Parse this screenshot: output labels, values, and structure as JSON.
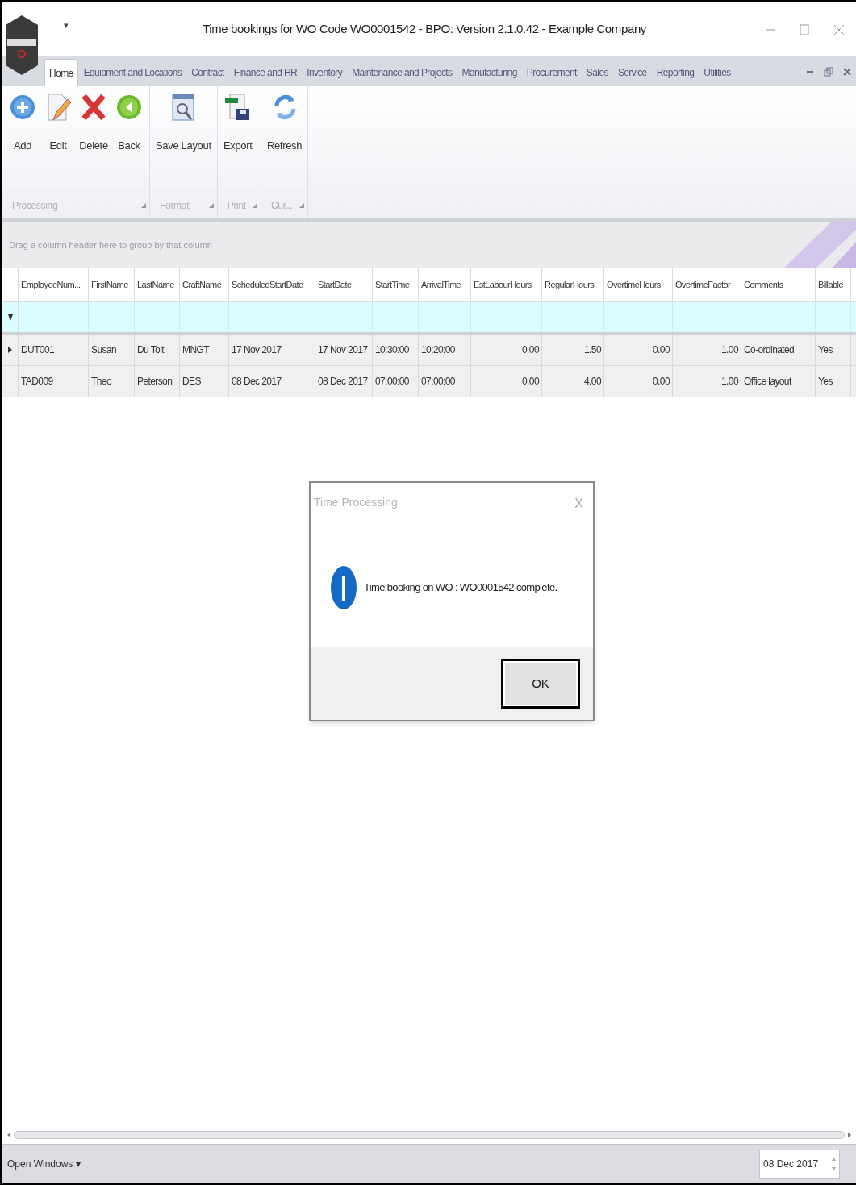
{
  "window": {
    "title": "Time bookings for WO Code WO0001542 - BPO: Version 2.1.0.42 - Example Company",
    "quick_access": "▾"
  },
  "tabs": [
    {
      "label": "Home",
      "selected": true
    },
    {
      "label": "Equipment and Locations",
      "selected": false
    },
    {
      "label": "Contract",
      "selected": false
    },
    {
      "label": "Finance and HR",
      "selected": false
    },
    {
      "label": "Inventory",
      "selected": false
    },
    {
      "label": "Maintenance and Projects",
      "selected": false
    },
    {
      "label": "Manufacturing",
      "selected": false
    },
    {
      "label": "Procurement",
      "selected": false
    },
    {
      "label": "Sales",
      "selected": false
    },
    {
      "label": "Service",
      "selected": false
    },
    {
      "label": "Reporting",
      "selected": false
    },
    {
      "label": "Utilities",
      "selected": false
    }
  ],
  "ribbon_groups": [
    {
      "label": "Processing",
      "buttons": [
        {
          "label": "Add",
          "kind": "add"
        },
        {
          "label": "Edit",
          "kind": "edit"
        },
        {
          "label": "Delete",
          "kind": "delete"
        },
        {
          "label": "Back",
          "kind": "back"
        }
      ]
    },
    {
      "label": "Format",
      "buttons": [
        {
          "label": "Save Layout",
          "kind": "layout"
        }
      ]
    },
    {
      "label": "Print",
      "buttons": [
        {
          "label": "Export",
          "kind": "export"
        }
      ]
    },
    {
      "label": "Cur...",
      "buttons": [
        {
          "label": "Refresh",
          "kind": "refresh"
        }
      ]
    }
  ],
  "grid": {
    "group_hint": "Drag a column header here to group by that column",
    "columns": [
      {
        "label": "EmployeeNum...",
        "kind": "text"
      },
      {
        "label": "FirstName",
        "kind": "text"
      },
      {
        "label": "LastName",
        "kind": "text"
      },
      {
        "label": "CraftName",
        "kind": "text"
      },
      {
        "label": "ScheduledStartDate",
        "kind": "text"
      },
      {
        "label": "StartDate",
        "kind": "text"
      },
      {
        "label": "StartTime",
        "kind": "text"
      },
      {
        "label": "ArrivalTime",
        "kind": "text"
      },
      {
        "label": "EstLabourHours",
        "kind": "number"
      },
      {
        "label": "RegularHours",
        "kind": "number"
      },
      {
        "label": "OvertimeHours",
        "kind": "number"
      },
      {
        "label": "OvertimeFactor",
        "kind": "number"
      },
      {
        "label": "Comments",
        "kind": "text"
      },
      {
        "label": "Billable",
        "kind": "text"
      }
    ],
    "rows": [
      {
        "current": true,
        "cells": [
          "DUT001",
          "Susan",
          "Du Toit",
          "MNGT",
          "17 Nov 2017",
          "17 Nov 2017",
          "10:30:00",
          "10:20:00",
          "0.00",
          "1.50",
          "0.00",
          "1.00",
          "Co-ordinated",
          "Yes"
        ]
      },
      {
        "current": false,
        "cells": [
          "TAD009",
          "Theo",
          "Peterson",
          "DES",
          "08 Dec 2017",
          "08 Dec 2017",
          "07:00:00",
          "07:00:00",
          "0.00",
          "4.00",
          "0.00",
          "1.00",
          "Office layout",
          "Yes"
        ]
      }
    ]
  },
  "dialog": {
    "title": "Time Processing",
    "close": "X",
    "message": "Time booking on WO : WO0001542 complete.",
    "button": "OK"
  },
  "status_bar": {
    "open_windows": "Open Windows ▾",
    "date": "08 Dec 2017"
  }
}
